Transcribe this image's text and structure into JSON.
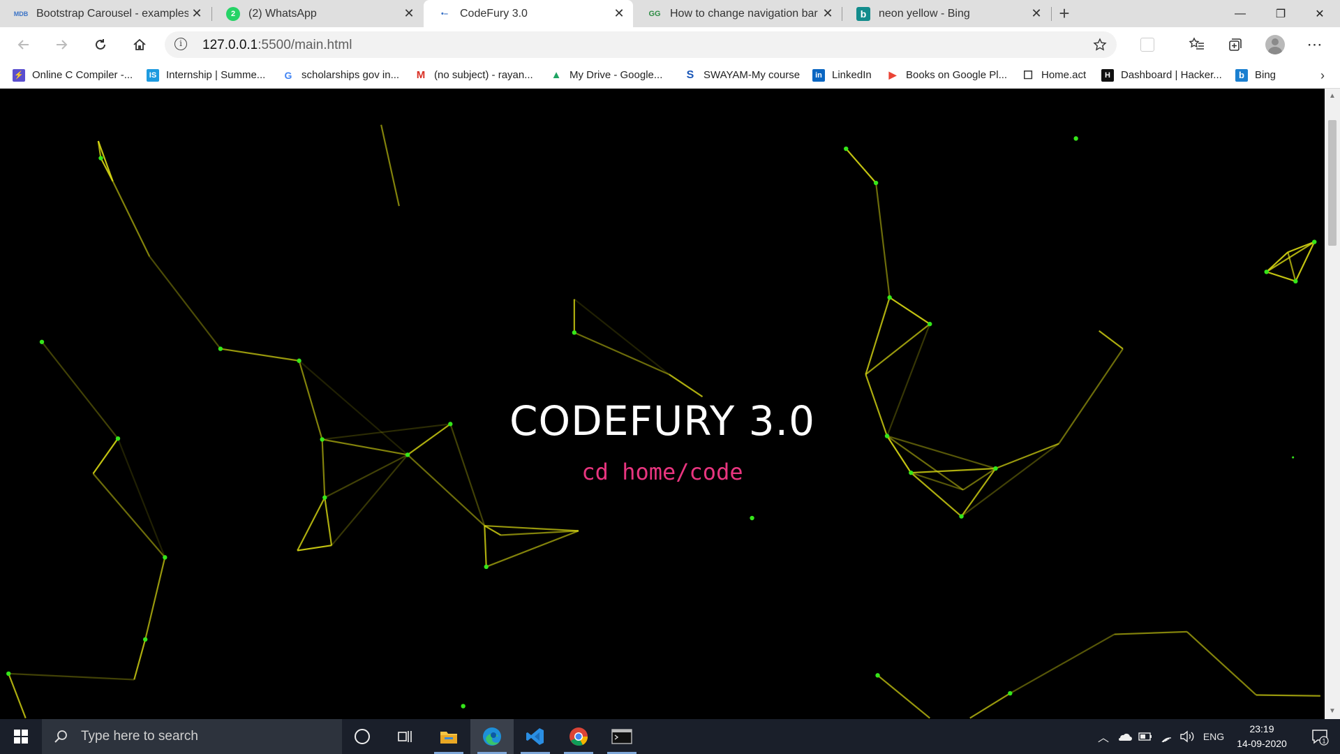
{
  "browser": {
    "tabs": [
      {
        "title": "Bootstrap Carousel - examples, t",
        "favicon": "mdb-icon",
        "favicon_text": "MDB",
        "active": false
      },
      {
        "title": "(2) WhatsApp",
        "favicon": "whatsapp-icon",
        "favicon_text": "2",
        "active": false
      },
      {
        "title": "CodeFury 3.0",
        "favicon": "vscode-live-icon",
        "favicon_text": "•–",
        "active": true
      },
      {
        "title": "How to change navigation bar co",
        "favicon": "geeksforgeeks-icon",
        "favicon_text": "GG",
        "active": false
      },
      {
        "title": "neon yellow - Bing",
        "favicon": "bing-icon",
        "favicon_text": "b",
        "active": false
      }
    ],
    "new_tab_label": "+",
    "window_controls": {
      "minimize": "—",
      "maximize": "❐",
      "close": "✕"
    },
    "address": {
      "host": "127.0.0.1",
      "rest": ":5500/main.html"
    },
    "bookmarks": [
      {
        "label": "Online C Compiler -...",
        "icon": "replit-icon",
        "color": "#5b4fcf",
        "glyph": "⚡"
      },
      {
        "label": "Internship | Summe...",
        "icon": "internshala-icon",
        "color": "#1d9be0",
        "glyph": "IS"
      },
      {
        "label": "scholarships gov in...",
        "icon": "google-icon",
        "color": "#ffffff",
        "glyph": "G"
      },
      {
        "label": "(no subject) - rayan...",
        "icon": "gmail-icon",
        "color": "#ffffff",
        "glyph": "M"
      },
      {
        "label": "My Drive - Google...",
        "icon": "google-drive-icon",
        "color": "#ffffff",
        "glyph": "▲"
      },
      {
        "label": "SWAYAM-My course",
        "icon": "swayam-icon",
        "color": "#ffffff",
        "glyph": "S"
      },
      {
        "label": "LinkedIn",
        "icon": "linkedin-icon",
        "color": "#0a66c2",
        "glyph": "in"
      },
      {
        "label": "Books on Google Pl...",
        "icon": "google-play-icon",
        "color": "#ffffff",
        "glyph": "▶"
      },
      {
        "label": "Home.act",
        "icon": "page-icon",
        "color": "#ffffff",
        "glyph": "☐"
      },
      {
        "label": "Dashboard | Hacker...",
        "icon": "hackerrank-icon",
        "color": "#111111",
        "glyph": "H"
      },
      {
        "label": "Bing",
        "icon": "bing-icon",
        "color": "#1a7fd0",
        "glyph": "b"
      }
    ]
  },
  "page": {
    "title": "CODEFURY 3.0",
    "subtitle": "cd home/code",
    "background": "#000000",
    "particle_color": "#d8d813",
    "node_color": "#35e61a",
    "title_color": "#ffffff",
    "subtitle_color": "#e8357f"
  },
  "taskbar": {
    "search_placeholder": "Type here to search",
    "apps": [
      "cortana-icon",
      "task-view-icon",
      "file-explorer-icon",
      "edge-icon",
      "vscode-icon",
      "chrome-icon",
      "terminal-icon"
    ],
    "language": "ENG",
    "time": "23:19",
    "date": "14-09-2020",
    "notification_count": "1"
  }
}
